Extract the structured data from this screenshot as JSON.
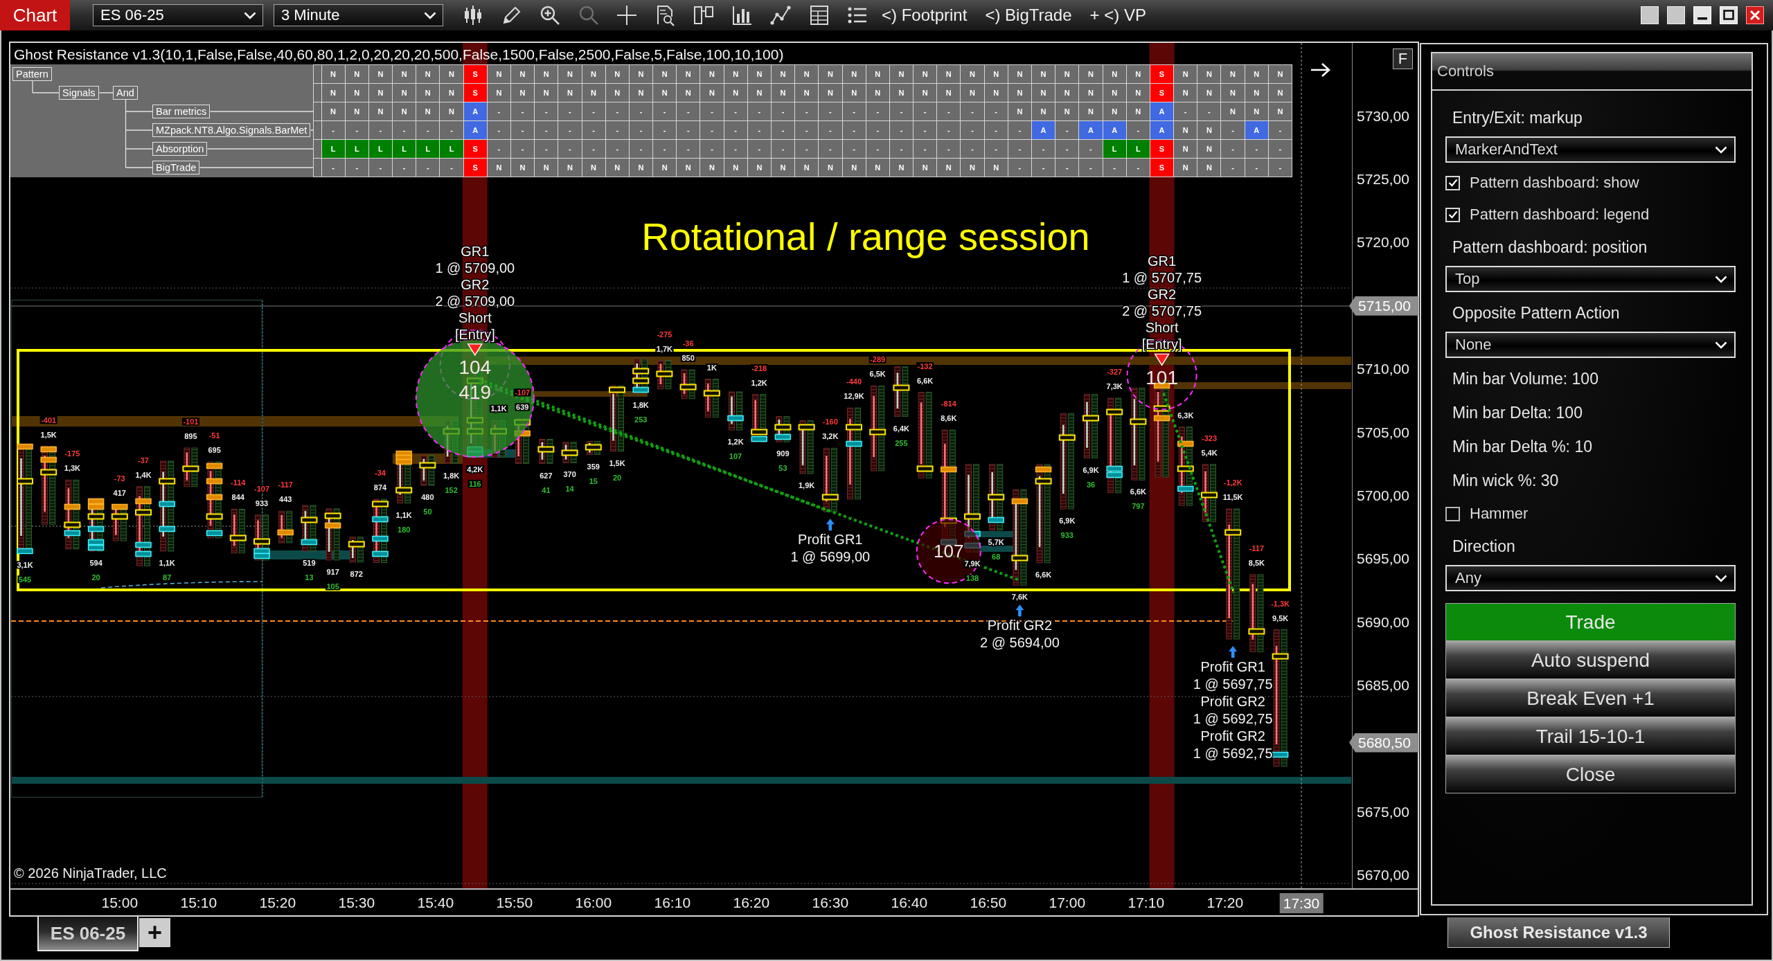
{
  "window": {
    "title": "Chart"
  },
  "toolbar": {
    "instrument": "ES 06-25",
    "interval": "3 Minute",
    "indicators": [
      "<) Footprint",
      "<) BigTrade",
      "+ <) VP"
    ]
  },
  "chart": {
    "indicator_title": "Ghost Resistance v1.3(10,1,False,False,40,60,80,1,2,0,20,20,20,500,False,1500,False,2500,False,5,False,100,10,100)",
    "dashboard": {
      "legend": [
        {
          "label": "Pattern",
          "children": [
            {
              "label": "Signals",
              "children": [
                {
                  "label": "And",
                  "children": [
                    {
                      "label": "Bar metrics"
                    },
                    {
                      "label": "MZpack.NT8.Algo.Signals.BarMet"
                    },
                    {
                      "label": "Absorption"
                    },
                    {
                      "label": "BigTrade"
                    }
                  ]
                }
              ]
            }
          ]
        }
      ],
      "rows": [
        {
          "cells": [
            {
              "text": "N"
            },
            {
              "text": "N"
            },
            {
              "text": "N"
            },
            {
              "text": "N"
            },
            {
              "text": "N"
            },
            {
              "text": "N"
            },
            {
              "text": "S",
              "color": "#ff0000"
            },
            {
              "text": "N"
            },
            {
              "text": "N"
            },
            {
              "text": "N"
            },
            {
              "text": "N"
            },
            {
              "text": "N"
            },
            {
              "text": "N"
            },
            {
              "text": "N"
            },
            {
              "text": "N"
            },
            {
              "text": "N"
            },
            {
              "text": "N"
            },
            {
              "text": "N"
            },
            {
              "text": "N"
            },
            {
              "text": "N"
            },
            {
              "text": "N"
            },
            {
              "text": "N"
            },
            {
              "text": "N"
            },
            {
              "text": "N"
            },
            {
              "text": "N"
            },
            {
              "text": "N"
            },
            {
              "text": "N"
            },
            {
              "text": "N"
            },
            {
              "text": "N"
            },
            {
              "text": "N"
            },
            {
              "text": "N"
            },
            {
              "text": "N"
            },
            {
              "text": "N"
            },
            {
              "text": "N"
            },
            {
              "text": "N"
            },
            {
              "text": "S",
              "color": "#ff0000"
            },
            {
              "text": "N"
            },
            {
              "text": "N"
            },
            {
              "text": "N"
            },
            {
              "text": "N"
            },
            {
              "text": "N"
            }
          ]
        },
        {
          "cells": [
            {
              "text": "N"
            },
            {
              "text": "N"
            },
            {
              "text": "N"
            },
            {
              "text": "N"
            },
            {
              "text": "N"
            },
            {
              "text": "N"
            },
            {
              "text": "S",
              "color": "#ff0000"
            },
            {
              "text": "N"
            },
            {
              "text": "N"
            },
            {
              "text": "N"
            },
            {
              "text": "N"
            },
            {
              "text": "N"
            },
            {
              "text": "N"
            },
            {
              "text": "N"
            },
            {
              "text": "N"
            },
            {
              "text": "N"
            },
            {
              "text": "N"
            },
            {
              "text": "N"
            },
            {
              "text": "N"
            },
            {
              "text": "N"
            },
            {
              "text": "N"
            },
            {
              "text": "N"
            },
            {
              "text": "N"
            },
            {
              "text": "N"
            },
            {
              "text": "N"
            },
            {
              "text": "N"
            },
            {
              "text": "N"
            },
            {
              "text": "N"
            },
            {
              "text": "N"
            },
            {
              "text": "N"
            },
            {
              "text": "N"
            },
            {
              "text": "N"
            },
            {
              "text": "N"
            },
            {
              "text": "N"
            },
            {
              "text": "N"
            },
            {
              "text": "S",
              "color": "#ff0000"
            },
            {
              "text": "N"
            },
            {
              "text": "N"
            },
            {
              "text": "N"
            },
            {
              "text": "N"
            },
            {
              "text": "N"
            }
          ]
        },
        {
          "cells": [
            {
              "text": "N"
            },
            {
              "text": "N"
            },
            {
              "text": "N"
            },
            {
              "text": "N"
            },
            {
              "text": "N"
            },
            {
              "text": "N"
            },
            {
              "text": "A",
              "color": "#4169e1"
            },
            {
              "text": "-"
            },
            {
              "text": "-"
            },
            {
              "text": "-"
            },
            {
              "text": "-"
            },
            {
              "text": "-"
            },
            {
              "text": "-"
            },
            {
              "text": "-"
            },
            {
              "text": "-"
            },
            {
              "text": "-"
            },
            {
              "text": "-"
            },
            {
              "text": "-"
            },
            {
              "text": "-"
            },
            {
              "text": "-"
            },
            {
              "text": "-"
            },
            {
              "text": "-"
            },
            {
              "text": "-"
            },
            {
              "text": "-"
            },
            {
              "text": "-"
            },
            {
              "text": "-"
            },
            {
              "text": "-"
            },
            {
              "text": "-"
            },
            {
              "text": "-"
            },
            {
              "text": "N"
            },
            {
              "text": "N"
            },
            {
              "text": "N"
            },
            {
              "text": "N"
            },
            {
              "text": "N"
            },
            {
              "text": "N"
            },
            {
              "text": "A",
              "color": "#4169e1"
            },
            {
              "text": "-"
            },
            {
              "text": "-"
            },
            {
              "text": "N"
            },
            {
              "text": "N"
            },
            {
              "text": "N"
            }
          ]
        },
        {
          "cells": [
            {
              "text": "-"
            },
            {
              "text": "-"
            },
            {
              "text": "-"
            },
            {
              "text": "-"
            },
            {
              "text": "-"
            },
            {
              "text": "-"
            },
            {
              "text": "A",
              "color": "#4169e1"
            },
            {
              "text": "-"
            },
            {
              "text": "-"
            },
            {
              "text": "-"
            },
            {
              "text": "-"
            },
            {
              "text": "-"
            },
            {
              "text": "-"
            },
            {
              "text": "-"
            },
            {
              "text": "-"
            },
            {
              "text": "-"
            },
            {
              "text": "-"
            },
            {
              "text": "-"
            },
            {
              "text": "-"
            },
            {
              "text": "-"
            },
            {
              "text": "-"
            },
            {
              "text": "-"
            },
            {
              "text": "-"
            },
            {
              "text": "-"
            },
            {
              "text": "-"
            },
            {
              "text": "-"
            },
            {
              "text": "-"
            },
            {
              "text": "-"
            },
            {
              "text": "-"
            },
            {
              "text": "-"
            },
            {
              "text": "A",
              "color": "#4169e1"
            },
            {
              "text": "-"
            },
            {
              "text": "A",
              "color": "#4169e1"
            },
            {
              "text": "A",
              "color": "#4169e1"
            },
            {
              "text": "-"
            },
            {
              "text": "A",
              "color": "#4169e1"
            },
            {
              "text": "N"
            },
            {
              "text": "N"
            },
            {
              "text": "-"
            },
            {
              "text": "A",
              "color": "#4169e1"
            },
            {
              "text": "-"
            }
          ]
        },
        {
          "cells": [
            {
              "text": "L",
              "color": "#008000"
            },
            {
              "text": "L",
              "color": "#008000"
            },
            {
              "text": "L",
              "color": "#008000"
            },
            {
              "text": "L",
              "color": "#008000"
            },
            {
              "text": "L",
              "color": "#008000"
            },
            {
              "text": "L",
              "color": "#008000"
            },
            {
              "text": "S",
              "color": "#ff0000"
            },
            {
              "text": "-"
            },
            {
              "text": "-"
            },
            {
              "text": "-"
            },
            {
              "text": "-"
            },
            {
              "text": "-"
            },
            {
              "text": "-"
            },
            {
              "text": "-"
            },
            {
              "text": "-"
            },
            {
              "text": "-"
            },
            {
              "text": "-"
            },
            {
              "text": "-"
            },
            {
              "text": "-"
            },
            {
              "text": "-"
            },
            {
              "text": "-"
            },
            {
              "text": "-"
            },
            {
              "text": "-"
            },
            {
              "text": "-"
            },
            {
              "text": "-"
            },
            {
              "text": "-"
            },
            {
              "text": "-"
            },
            {
              "text": "-"
            },
            {
              "text": "-"
            },
            {
              "text": "-"
            },
            {
              "text": "-"
            },
            {
              "text": "-"
            },
            {
              "text": "-"
            },
            {
              "text": "L",
              "color": "#008000"
            },
            {
              "text": "L",
              "color": "#008000"
            },
            {
              "text": "S",
              "color": "#ff0000"
            },
            {
              "text": "N"
            },
            {
              "text": "N"
            },
            {
              "text": "-"
            },
            {
              "text": "-"
            },
            {
              "text": "-"
            }
          ]
        },
        {
          "cells": [
            {
              "text": "-"
            },
            {
              "text": "-"
            },
            {
              "text": "-"
            },
            {
              "text": "-"
            },
            {
              "text": "-"
            },
            {
              "text": "-"
            },
            {
              "text": "S",
              "color": "#ff0000"
            },
            {
              "text": "N"
            },
            {
              "text": "N"
            },
            {
              "text": "N"
            },
            {
              "text": "N"
            },
            {
              "text": "N"
            },
            {
              "text": "N"
            },
            {
              "text": "N"
            },
            {
              "text": "N"
            },
            {
              "text": "N"
            },
            {
              "text": "N"
            },
            {
              "text": "N"
            },
            {
              "text": "N"
            },
            {
              "text": "N"
            },
            {
              "text": "N"
            },
            {
              "text": "N"
            },
            {
              "text": "N"
            },
            {
              "text": "N"
            },
            {
              "text": "N"
            },
            {
              "text": "N"
            },
            {
              "text": "N"
            },
            {
              "text": "N"
            },
            {
              "text": "N"
            },
            {
              "text": "-"
            },
            {
              "text": "-"
            },
            {
              "text": "-"
            },
            {
              "text": "-"
            },
            {
              "text": "-"
            },
            {
              "text": "-"
            },
            {
              "text": "S",
              "color": "#ff0000"
            },
            {
              "text": "N"
            },
            {
              "text": "N"
            },
            {
              "text": "-"
            },
            {
              "text": "-"
            },
            {
              "text": "-"
            }
          ]
        }
      ]
    },
    "session_label": "Rotational / range session",
    "bars": [
      {
        "kind": "up",
        "highlighted": false,
        "volume": "3,1K",
        "delta": "545"
      },
      {
        "kind": "down",
        "highlighted": false,
        "volume": "1,5K",
        "delta": "-401"
      },
      {
        "kind": "down",
        "highlighted": false,
        "volume": "1,3K",
        "delta": "-175"
      },
      {
        "kind": "up",
        "highlighted": false,
        "volume": "594",
        "delta": "20"
      },
      {
        "kind": "down",
        "highlighted": false,
        "volume": "417",
        "delta": "-73"
      },
      {
        "kind": "down",
        "highlighted": false,
        "volume": "1,4K",
        "delta": "-37"
      },
      {
        "kind": "up",
        "highlighted": false,
        "volume": "1,1K",
        "delta": "87"
      },
      {
        "kind": "down",
        "highlighted": false,
        "volume": "895",
        "delta": "-101"
      },
      {
        "kind": "down",
        "highlighted": false,
        "volume": "695",
        "delta": "-51"
      },
      {
        "kind": "down",
        "highlighted": false,
        "volume": "844",
        "delta": "-114"
      },
      {
        "kind": "down",
        "highlighted": false,
        "volume": "933",
        "delta": "-107"
      },
      {
        "kind": "down",
        "highlighted": false,
        "volume": "443",
        "delta": "-117"
      },
      {
        "kind": "up",
        "highlighted": false,
        "volume": "519",
        "delta": "13"
      },
      {
        "kind": "up",
        "highlighted": false,
        "volume": "917",
        "delta": "105"
      },
      {
        "kind": "up",
        "highlighted": false,
        "volume": "872"
      },
      {
        "kind": "down",
        "highlighted": false,
        "volume": "874",
        "delta": "-34"
      },
      {
        "kind": "up",
        "highlighted": false,
        "volume": "1,1K",
        "delta": "180"
      },
      {
        "kind": "up",
        "highlighted": false,
        "volume": "480",
        "delta": "50"
      },
      {
        "kind": "up",
        "highlighted": false,
        "volume": "1,8K",
        "delta": "152"
      },
      {
        "kind": "up",
        "highlighted": true,
        "volume": "4,2K",
        "delta": "116",
        "entry": {
          "kind": "short",
          "lines": [
            "GR1",
            "1 @ 5709,00",
            "GR2",
            "2 @ 5709,00",
            "Short",
            "[Entry]"
          ]
        },
        "circles": [
          {
            "kind": "ring",
            "text": "104"
          },
          {
            "kind": "disc",
            "text": "419"
          }
        ]
      },
      {
        "kind": "down",
        "highlighted": false,
        "volume": "1,1K"
      },
      {
        "kind": "down",
        "highlighted": false,
        "volume": "639",
        "delta": "-107"
      },
      {
        "kind": "up",
        "highlighted": false,
        "volume": "627",
        "delta": "41"
      },
      {
        "kind": "up",
        "highlighted": false,
        "volume": "370",
        "delta": "14"
      },
      {
        "kind": "up",
        "highlighted": false,
        "volume": "359",
        "delta": "15"
      },
      {
        "kind": "up",
        "highlighted": false,
        "volume": "1,5K",
        "delta": "20"
      },
      {
        "kind": "up",
        "highlighted": false,
        "volume": "1,8K",
        "delta": "253"
      },
      {
        "kind": "down",
        "highlighted": false,
        "volume": "1,7K",
        "delta": "-275"
      },
      {
        "kind": "down",
        "highlighted": false,
        "volume": "850",
        "delta": "-36"
      },
      {
        "kind": "down",
        "highlighted": false,
        "volume": "1K"
      },
      {
        "kind": "up",
        "highlighted": false,
        "volume": "1,2K",
        "delta": "107"
      },
      {
        "kind": "down",
        "highlighted": false,
        "volume": "1,2K",
        "delta": "-218"
      },
      {
        "kind": "up",
        "highlighted": false,
        "volume": "909",
        "delta": "53"
      },
      {
        "kind": "up",
        "highlighted": false,
        "volume": "1,9K"
      },
      {
        "kind": "down",
        "highlighted": false,
        "volume": "3,2K",
        "delta": "-160",
        "exit": {
          "lines": [
            "Profit GR1",
            "1 @ 5699,00"
          ]
        }
      },
      {
        "kind": "down",
        "highlighted": false,
        "volume": "12,9K",
        "delta": "-440"
      },
      {
        "kind": "down",
        "highlighted": false,
        "volume": "6,5K",
        "delta": "-289"
      },
      {
        "kind": "up",
        "highlighted": false,
        "volume": "6,4K",
        "delta": "255"
      },
      {
        "kind": "down",
        "highlighted": false,
        "volume": "6,6K",
        "delta": "-132"
      },
      {
        "kind": "down",
        "highlighted": false,
        "volume": "8,6K",
        "delta": "-814",
        "circles": [
          {
            "kind": "base",
            "text": "107"
          }
        ]
      },
      {
        "kind": "up",
        "highlighted": false,
        "volume": "7,9K",
        "delta": "138"
      },
      {
        "kind": "up",
        "highlighted": false,
        "volume": "5,7K",
        "delta": "68"
      },
      {
        "kind": "up",
        "highlighted": false,
        "volume": "7,6K",
        "exit": {
          "lines": [
            "Profit GR2",
            "2 @ 5694,00"
          ]
        }
      },
      {
        "kind": "up",
        "highlighted": false,
        "volume": "6,6K"
      },
      {
        "kind": "up",
        "highlighted": false,
        "volume": "6,9K",
        "delta": "933"
      },
      {
        "kind": "up",
        "highlighted": false,
        "volume": "6,9K",
        "delta": "36"
      },
      {
        "kind": "down",
        "highlighted": false,
        "volume": "7,3K",
        "delta": "-327"
      },
      {
        "kind": "up",
        "highlighted": false,
        "volume": "6,6K",
        "delta": "797"
      },
      {
        "kind": "down",
        "highlighted": true,
        "entry": {
          "kind": "short",
          "lines": [
            "GR1",
            "1 @ 5707,75",
            "GR2",
            "2 @ 5707,75",
            "Short",
            "[Entry]"
          ]
        },
        "circles": [
          {
            "kind": "ring",
            "text": "101"
          }
        ]
      },
      {
        "kind": "down",
        "highlighted": false,
        "volume": "6,3K"
      },
      {
        "kind": "down",
        "highlighted": false,
        "volume": "5,4K",
        "delta": "-323"
      },
      {
        "kind": "down",
        "highlighted": false,
        "volume": "11,5K",
        "delta": "-1,2K",
        "exit": {
          "lines": [
            "Profit GR1",
            "1 @ 5697,75",
            "Profit GR2",
            "1 @ 5692,75",
            "Profit GR2",
            "1 @ 5692,75"
          ]
        }
      },
      {
        "kind": "down",
        "highlighted": false,
        "volume": "8,5K",
        "delta": "-117"
      },
      {
        "kind": "down",
        "highlighted": false,
        "volume": "9,5K",
        "delta": "-1,3K"
      }
    ],
    "toggle_button": "F",
    "price_axis": {
      "labels": [
        "5730,00",
        "5725,00",
        "5720,00",
        "5710,00",
        "5705,00",
        "5700,00",
        "5695,00",
        "5690,00",
        "5685,00",
        "5675,00",
        "5670,00"
      ],
      "tags": [
        {
          "kind": "cursor",
          "text": "5715,00"
        },
        {
          "kind": "last",
          "text": "5680,50"
        }
      ]
    },
    "time_axis": {
      "labels": [
        "15:00",
        "15:10",
        "15:20",
        "15:30",
        "15:40",
        "15:50",
        "16:00",
        "16:10",
        "16:20",
        "16:30",
        "16:40",
        "16:50",
        "17:00",
        "17:10",
        "17:20"
      ],
      "current": "17:30"
    },
    "copyright": "© 2026 NinjaTrader, LLC"
  },
  "controls": {
    "title": "Controls",
    "items": [
      {
        "kind": "label",
        "text": "Entry/Exit: markup"
      },
      {
        "kind": "dropdown",
        "value": "MarkerAndText"
      },
      {
        "kind": "checkbox",
        "label": "Pattern dashboard: show",
        "checked": true
      },
      {
        "kind": "checkbox",
        "label": "Pattern dashboard: legend",
        "checked": true
      },
      {
        "kind": "label",
        "text": "Pattern dashboard: position"
      },
      {
        "kind": "dropdown",
        "value": "Top"
      },
      {
        "kind": "label",
        "text": "Opposite Pattern Action"
      },
      {
        "kind": "dropdown",
        "value": "None"
      },
      {
        "kind": "label",
        "text": "Min bar Volume: 100"
      },
      {
        "kind": "label",
        "text": "Min bar Delta: 100"
      },
      {
        "kind": "label",
        "text": "Min bar Delta %: 10"
      },
      {
        "kind": "label",
        "text": "Min wick %: 30"
      },
      {
        "kind": "checkbox",
        "label": "Hammer",
        "checked": false
      },
      {
        "kind": "label",
        "text": "Direction"
      },
      {
        "kind": "dropdown",
        "value": "Any"
      }
    ],
    "buttons": [
      {
        "label": "Trade",
        "on": true
      },
      {
        "label": "Auto suspend",
        "on": false
      },
      {
        "label": "Break Even +1",
        "on": false
      },
      {
        "label": "Trail 15-10-1",
        "on": false
      },
      {
        "label": "Close",
        "on": false
      }
    ]
  },
  "tabs": {
    "items": [
      {
        "label": "ES 06-25",
        "selected": true
      }
    ],
    "add": "+",
    "indicator_tab": "Ghost Resistance v1.3"
  }
}
